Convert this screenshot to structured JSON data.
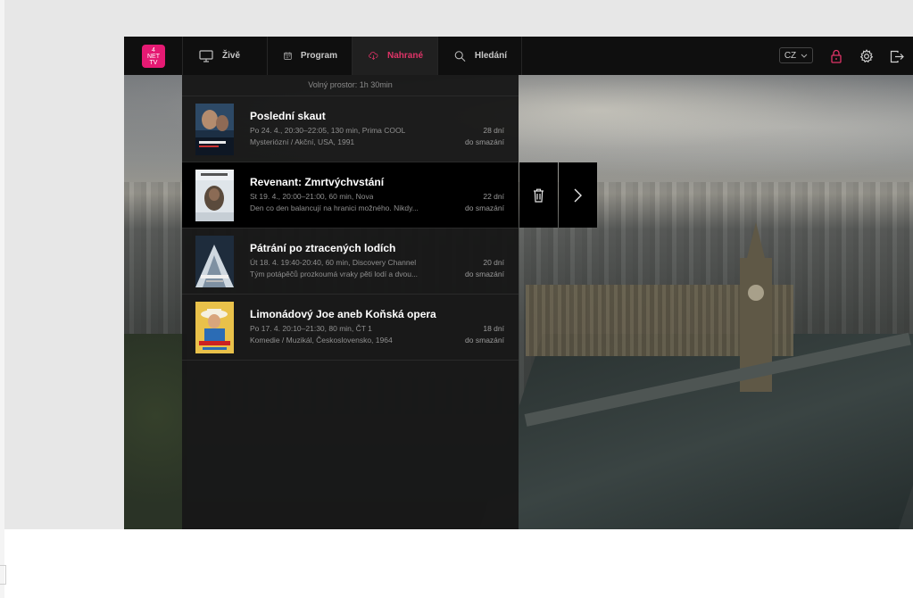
{
  "logo": {
    "line1": "4",
    "line2": "NET",
    "line3": "TV"
  },
  "nav": [
    {
      "label": "Živě",
      "icon": "tv-icon",
      "active": false
    },
    {
      "label": "Program",
      "icon": "calendar-icon",
      "active": false
    },
    {
      "label": "Nahrané",
      "icon": "cloud-download-icon",
      "active": true
    },
    {
      "label": "Hledání",
      "icon": "search-icon",
      "active": false
    }
  ],
  "toolbar": {
    "language": "CZ"
  },
  "panel": {
    "free_space": "Volný prostor: 1h 30min",
    "recordings": [
      {
        "title": "Poslední skaut",
        "line1": "Po 24. 4., 20:30–22:05, 130 min, Prima COOL",
        "line2": "Mysteriózní / Akční, USA, 1991",
        "days": "28 dní",
        "until": "do smazání"
      },
      {
        "title": "Revenant: Zmrtvýchvstání",
        "line1": "St 19. 4., 20:00–21:00, 60 min, Nova",
        "line2": "Den co den balancují na hranici možného. Nikdy...",
        "days": "22 dní",
        "until": "do smazání"
      },
      {
        "title": "Pátrání po ztracených lodích",
        "line1": "Út 18. 4. 19:40-20:40, 60 min, Discovery Channel",
        "line2": "Tým potápěčů prozkoumá vraky pěti lodí a dvou...",
        "days": "20 dní",
        "until": "do smazání"
      },
      {
        "title": "Limonádový Joe aneb Koňská opera",
        "line1": "Po 17. 4. 20:10–21:30, 80 min, ČT 1",
        "line2": "Komedie / Muzikál, Československo, 1964",
        "days": "18 dní",
        "until": "do smazání"
      }
    ]
  },
  "colors": {
    "accent": "#e03468",
    "logo_bg": "#e51a73"
  }
}
